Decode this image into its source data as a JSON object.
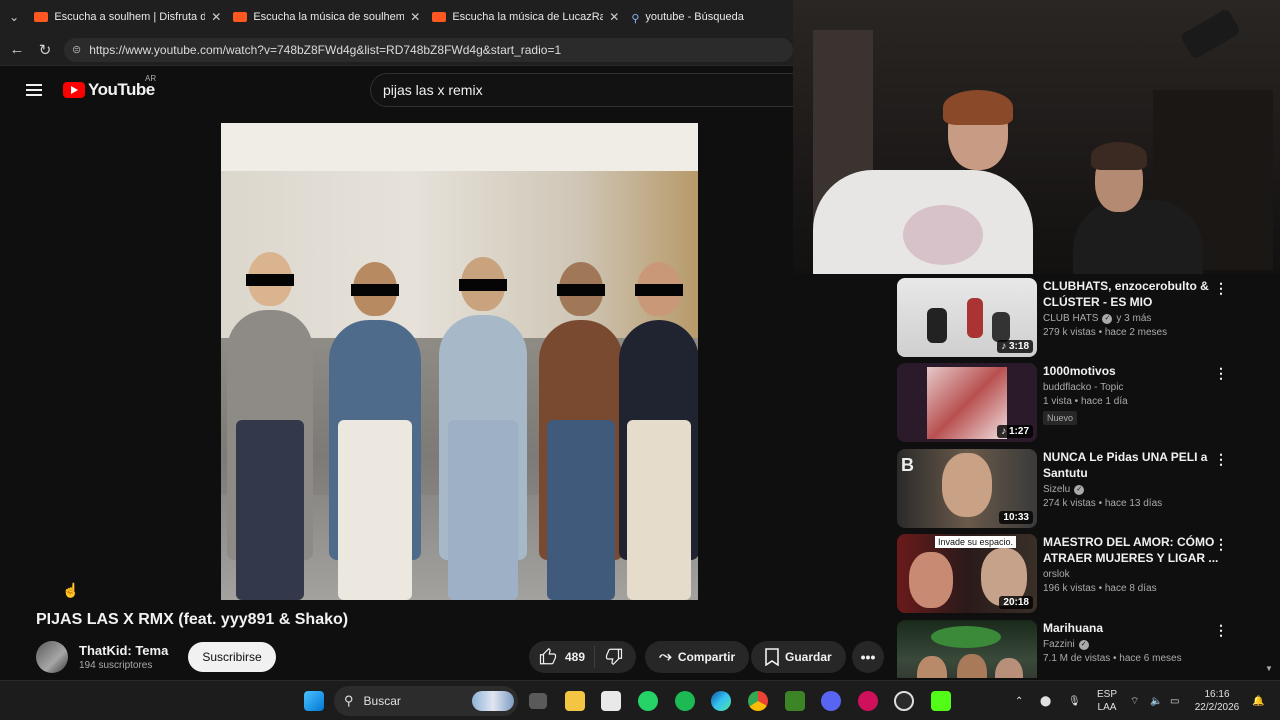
{
  "browser": {
    "tabs": [
      {
        "title": "Escucha a soulhem | Disfruta de la",
        "icon": "soundcloud-icon"
      },
      {
        "title": "Escucha la música de soulhem | Di",
        "icon": "soundcloud-icon"
      },
      {
        "title": "Escucha la música de LucazRage |",
        "icon": "soundcloud-icon"
      },
      {
        "title": "youtube - Búsqueda",
        "icon": "search-icon"
      }
    ],
    "url": "https://www.youtube.com/watch?v=748bZ8FWd4g&list=RD748bZ8FWd4g&start_radio=1"
  },
  "header": {
    "logo_text": "YouTube",
    "region": "AR",
    "search_value": "pijas las x remix"
  },
  "video": {
    "title": "PIJAS LAS X RMX (feat. yyy891 & Shako)",
    "channel": "ThatKid: Tema",
    "subscribers": "194 suscriptores",
    "subscribe_label": "Suscribirse",
    "likes": "489",
    "share_label": "Compartir",
    "save_label": "Guardar"
  },
  "suggestions": [
    {
      "title": "CLUBHATS, enzocerobulto & CLÚSTER - ES MIO",
      "channel": "CLUB HATS",
      "channel_extra": "y 3 más",
      "verified": true,
      "meta": "279 k vistas • hace 2 meses",
      "duration": "3:18",
      "music": true,
      "badge": ""
    },
    {
      "title": "1000motivos",
      "channel": "buddflacko - Topic",
      "channel_extra": "",
      "verified": false,
      "meta": "1 vista • hace 1 día",
      "duration": "1:27",
      "music": true,
      "badge": "Nuevo"
    },
    {
      "title": "NUNCA Le Pidas UNA PELI a Santutu",
      "channel": "Sizelu",
      "channel_extra": "",
      "verified": true,
      "meta": "274 k vistas • hace 13 días",
      "duration": "10:33",
      "music": false,
      "badge": ""
    },
    {
      "title": "MAESTRO DEL AMOR: CÓMO ATRAER MUJERES Y LIGAR ...",
      "channel": "orslok",
      "channel_extra": "",
      "verified": false,
      "meta": "196 k vistas • hace 8 días",
      "duration": "20:18",
      "music": false,
      "badge": "",
      "thumb_text": "Invade su espacio."
    },
    {
      "title": "Marihuana",
      "channel": "Fazzini",
      "channel_extra": "",
      "verified": true,
      "meta": "7.1 M de vistas • hace 6 meses",
      "duration": "",
      "music": false,
      "badge": ""
    }
  ],
  "taskbar": {
    "search_label": "Buscar",
    "language": [
      "ESP",
      "LAA"
    ],
    "time": "16:16",
    "date": "22/2/2026"
  }
}
